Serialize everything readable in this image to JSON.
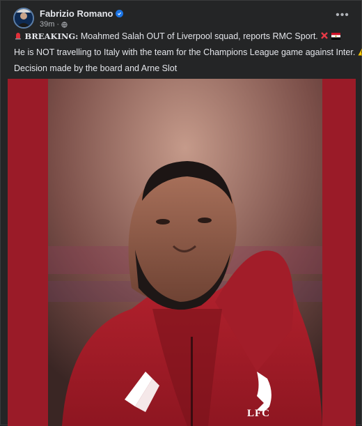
{
  "post": {
    "author": "Fabrizio Romano",
    "time": "39m",
    "separator": "·",
    "more_label": "•••",
    "lines": {
      "breaking_label": "BREAKING:",
      "line1": " Moahmed Salah OUT of Liverpool squad, reports RMC Sport.",
      "line2": "He is NOT travelling to Italy with the team for the Champions League game against Inter.",
      "line3": "Decision made by the board and Arne Slot"
    }
  },
  "image": {
    "description_icon": "player-photo",
    "crest_text": "LFC"
  },
  "colors": {
    "card_bg": "#242526",
    "image_bg": "#9a1b28",
    "verified": "#1b74e4"
  }
}
